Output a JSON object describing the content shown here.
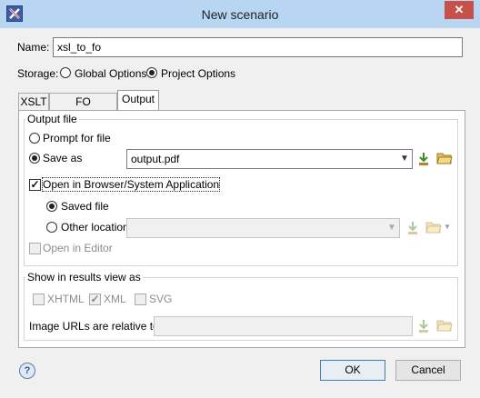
{
  "window": {
    "title": "New scenario"
  },
  "name": {
    "label": "Name:",
    "value": "xsl_to_fo"
  },
  "storage": {
    "label": "Storage:",
    "global_label": "Global Options",
    "project_label": "Project Options",
    "selected": "project"
  },
  "tabs": [
    {
      "label": "XSLT"
    },
    {
      "label": "FO Processor"
    },
    {
      "label": "Output"
    }
  ],
  "output_file": {
    "group_label": "Output file",
    "prompt_label": "Prompt for file",
    "save_as_label": "Save as",
    "save_as_value": "output.pdf",
    "open_browser_label": "Open in Browser/System Application",
    "saved_file_label": "Saved file",
    "other_location_label": "Other location",
    "open_editor_label": "Open in Editor"
  },
  "results": {
    "group_label": "Show in results view as",
    "xhtml_label": "XHTML",
    "xml_label": "XML",
    "svg_label": "SVG",
    "image_urls_label": "Image URLs are relative to:"
  },
  "buttons": {
    "ok": "OK",
    "cancel": "Cancel"
  },
  "colors": {
    "titlebar": "#b8d6f1",
    "close": "#c7504a",
    "default_button": "#3c7fb1"
  }
}
